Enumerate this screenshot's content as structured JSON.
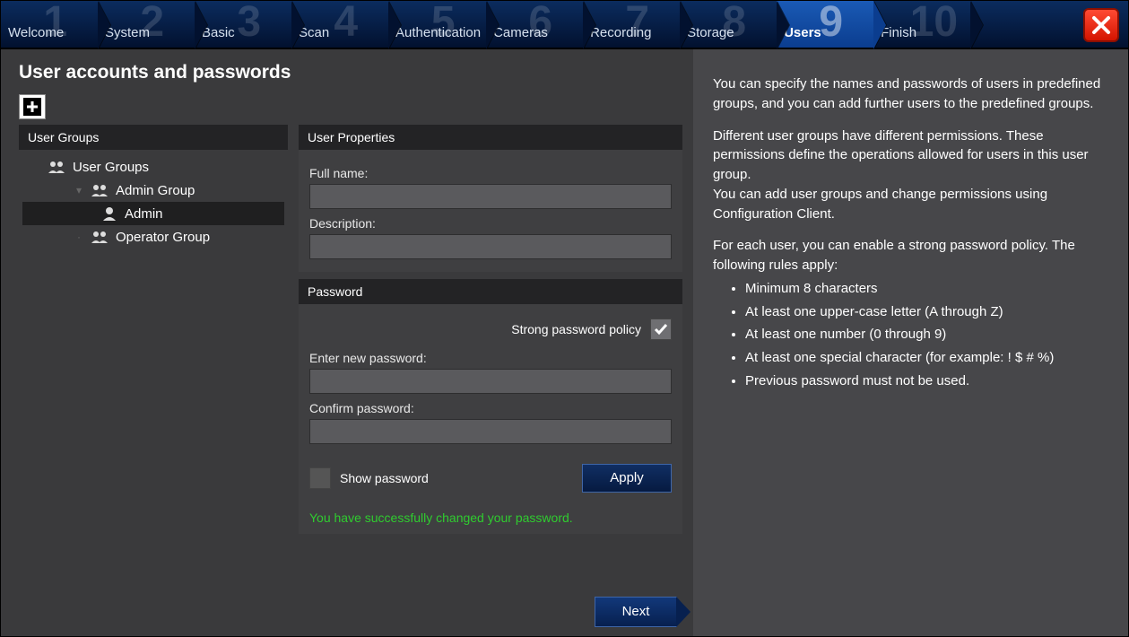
{
  "wizard": {
    "steps": [
      {
        "num": "1",
        "label": "Welcome"
      },
      {
        "num": "2",
        "label": "System"
      },
      {
        "num": "3",
        "label": "Basic"
      },
      {
        "num": "4",
        "label": "Scan"
      },
      {
        "num": "5",
        "label": "Authentication"
      },
      {
        "num": "6",
        "label": "Cameras"
      },
      {
        "num": "7",
        "label": "Recording"
      },
      {
        "num": "8",
        "label": "Storage"
      },
      {
        "num": "9",
        "label": "Users"
      },
      {
        "num": "10",
        "label": "Finish"
      }
    ],
    "active_index": 8
  },
  "page": {
    "title": "User accounts and passwords",
    "next_label": "Next"
  },
  "tree": {
    "header": "User Groups",
    "root": "User Groups",
    "admin_group": "Admin Group",
    "admin_user": "Admin",
    "operator_group": "Operator Group"
  },
  "form": {
    "user_props_header": "User Properties",
    "full_name_label": "Full name:",
    "full_name_value": "",
    "description_label": "Description:",
    "description_value": "",
    "password_header": "Password",
    "policy_label": "Strong password policy",
    "policy_checked": true,
    "enter_pw_label": "Enter new password:",
    "enter_pw_value": "",
    "confirm_pw_label": "Confirm password:",
    "confirm_pw_value": "",
    "show_pw_label": "Show password",
    "show_pw_checked": false,
    "apply_label": "Apply",
    "status": "You have successfully changed your password."
  },
  "help": {
    "p1": "You can specify the names and passwords of users in predefined groups, and you can add further users to the predefined groups.",
    "p2": "Different user groups have different permissions. These permissions define the operations allowed for users in this user group.",
    "p2b": "You can add user groups and change permissions using Configuration Client.",
    "p3": "For each user, you can enable a strong password policy. The following rules apply:",
    "rules": [
      "Minimum 8 characters",
      "At least one upper-case letter (A through Z)",
      "At least one number (0 through 9)",
      "At least one special character (for example: ! $ # %)",
      "Previous password must not be used."
    ]
  }
}
